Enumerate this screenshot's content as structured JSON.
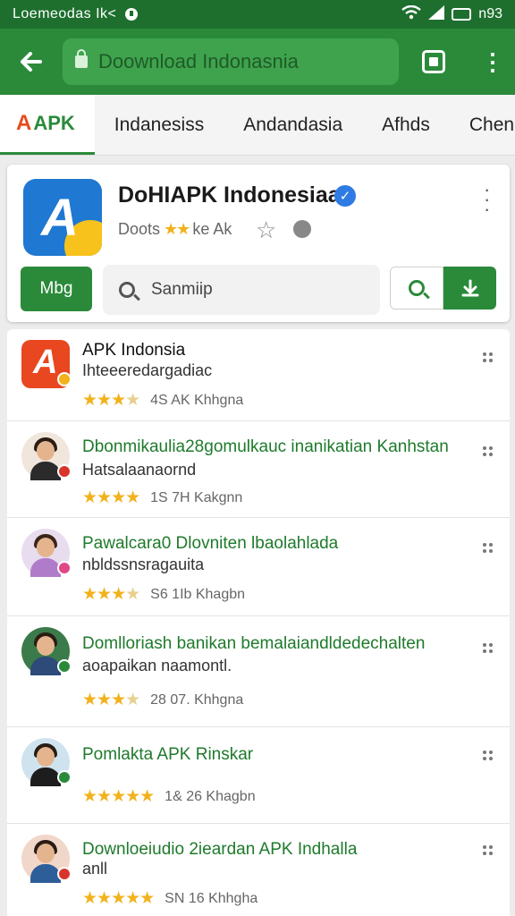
{
  "status_bar": {
    "left_text": "Loemeodas Ik<",
    "time": "n93"
  },
  "app_bar": {
    "url_text": "Doownload Indonasnia"
  },
  "tabs": [
    "Indanesiss",
    "Andandasia",
    "Afhds",
    "Chen"
  ],
  "tab_logo": {
    "mark": "A",
    "label": "APK"
  },
  "header": {
    "title": "DoHIAPK Indonesiaa",
    "sub_left": "Doots",
    "stars": "★★",
    "sub_right": "ke Ak",
    "map_label": "Mbg",
    "search_placeholder": "Sanmiip"
  },
  "icons": {
    "back": "back-arrow-icon",
    "lock": "lock-icon",
    "tabs": "tab-switcher-icon",
    "more": "more-vert-icon",
    "verified": "verified-badge-icon",
    "star": "star-outline-icon",
    "globe": "globe-icon",
    "search": "search-icon",
    "download": "download-icon"
  },
  "list": [
    {
      "name": "APK Indonsia",
      "desc": "Ihteeeredargadiac",
      "stars": 4,
      "meta": "4S  AK  Khhgna"
    },
    {
      "name": "Dbonmikaulia28gomulkauc inanikatian Kanhstan",
      "desc": "Hatsalaanaornd",
      "stars": 4,
      "meta": "1S  7H  Kakgnn"
    },
    {
      "name": "Pawalcara0 Dlovniten lbaolahlada",
      "desc": "nbldssnsragauita",
      "stars": 4,
      "meta": "S6  1Ib  Khagbn"
    },
    {
      "name": "Domlloriash banikan bemalaiandldedechalten",
      "desc": "aoapaikan naamontl.",
      "stars": 4,
      "meta": "28  07.  Khhgna"
    },
    {
      "name": "Pomlakta APK Rinskar",
      "desc": "",
      "stars": 5,
      "meta": "1&  26  Khagbn"
    },
    {
      "name": "Downloeiudio 2ieardan APK Indhalla",
      "desc": "anll",
      "stars": 5,
      "meta": "SN  16  Khhgha"
    }
  ],
  "colors": {
    "primary": "#2a8a3a",
    "status": "#1e6f2e",
    "star": "#f1b21c",
    "accent_red": "#e8471f",
    "verified_blue": "#2f7be5"
  }
}
